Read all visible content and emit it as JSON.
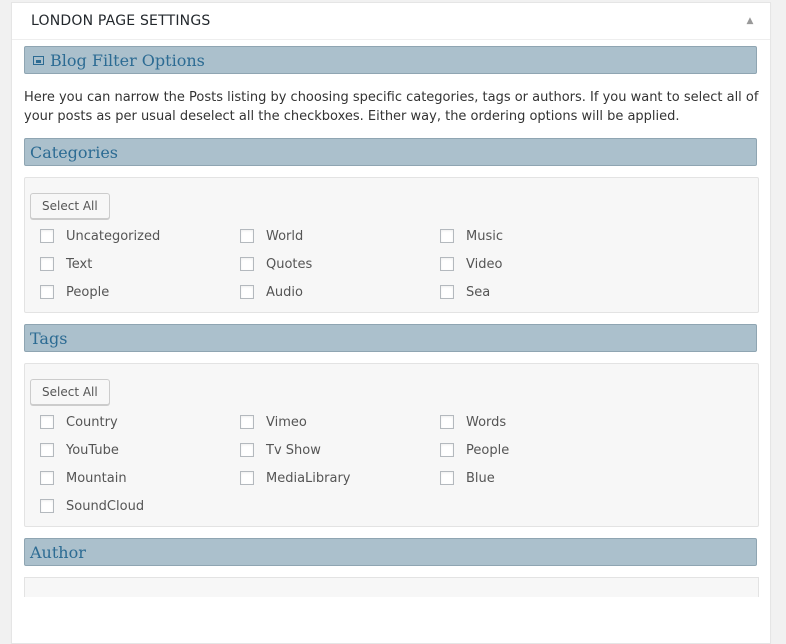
{
  "panel": {
    "title": "LONDON PAGE SETTINGS",
    "toggle_icon": "triangle-up-icon"
  },
  "blog_filter": {
    "heading": "Blog Filter Options",
    "heading_icon": "image-icon",
    "description": "Here you can narrow the Posts listing by choosing specific categories, tags or authors. If you want to select all of your posts as per usual deselect all the checkboxes. Either way, the ordering options will be applied."
  },
  "categories": {
    "heading": "Categories",
    "select_all_label": "Select All",
    "items": [
      {
        "label": "Uncategorized",
        "checked": false
      },
      {
        "label": "World",
        "checked": false
      },
      {
        "label": "Music",
        "checked": false
      },
      {
        "label": "Text",
        "checked": false
      },
      {
        "label": "Quotes",
        "checked": false
      },
      {
        "label": "Video",
        "checked": false
      },
      {
        "label": "People",
        "checked": false
      },
      {
        "label": "Audio",
        "checked": false
      },
      {
        "label": "Sea",
        "checked": false
      }
    ]
  },
  "tags": {
    "heading": "Tags",
    "select_all_label": "Select All",
    "items": [
      {
        "label": "Country",
        "checked": false
      },
      {
        "label": "Vimeo",
        "checked": false
      },
      {
        "label": "Words",
        "checked": false
      },
      {
        "label": "YouTube",
        "checked": false
      },
      {
        "label": "Tv Show",
        "checked": false
      },
      {
        "label": "People",
        "checked": false
      },
      {
        "label": "Mountain",
        "checked": false
      },
      {
        "label": "MediaLibrary",
        "checked": false
      },
      {
        "label": "Blue",
        "checked": false
      },
      {
        "label": "SoundCloud",
        "checked": false
      }
    ]
  },
  "author": {
    "heading": "Author"
  },
  "colors": {
    "section_bar_bg": "#abc0cc",
    "section_heading_text": "#2c6b93",
    "page_bg": "#f1f1f1"
  }
}
